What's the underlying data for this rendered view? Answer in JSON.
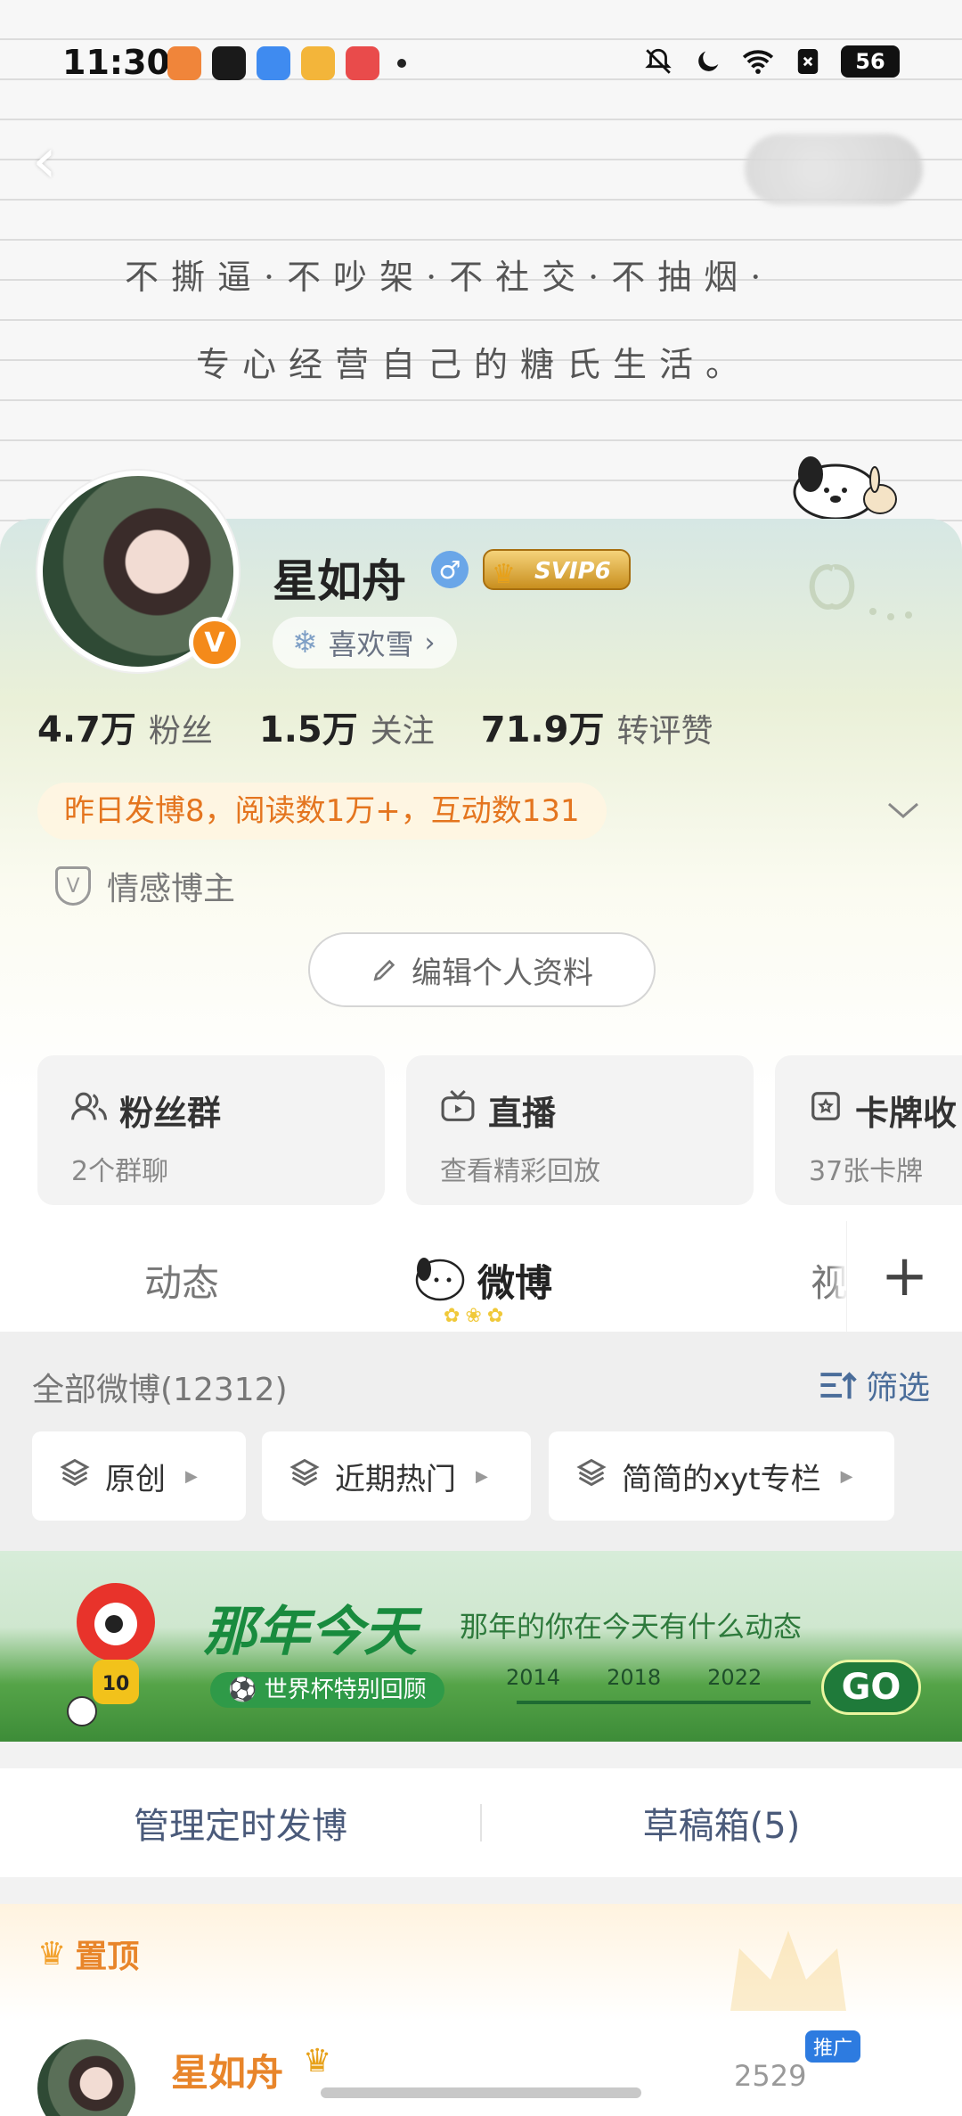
{
  "status_bar": {
    "time": "11:30",
    "app_icons": [
      {
        "name": "app-icon-video",
        "color": "#f0853a"
      },
      {
        "name": "app-icon-douyin",
        "color": "#1a1a1a"
      },
      {
        "name": "app-icon-browser",
        "color": "#3f8bf0"
      },
      {
        "name": "app-icon-reader",
        "color": "#f3b53a"
      },
      {
        "name": "app-icon-player",
        "color": "#e94b4b"
      }
    ],
    "battery": "56"
  },
  "banner": {
    "handwriting_line1": "不撕逼·不吵架·不社交·不抽烟·",
    "handwriting_line2": "专心经营自己的糖氏生活。"
  },
  "profile": {
    "name": "星如舟",
    "gender_symbol": "♂",
    "svip": "SVIP6",
    "like_tag": "喜欢雪",
    "like_arrow": "›",
    "verified_mark": "V",
    "stats": [
      {
        "value": "4.7万",
        "label": "粉丝"
      },
      {
        "value": "1.5万",
        "label": "关注"
      },
      {
        "value": "71.9万",
        "label": "转评赞"
      }
    ],
    "yesterday": "昨日发博8，阅读数1万+，互动数131",
    "tag": "情感博主",
    "edit_button": "编辑个人资料"
  },
  "features": [
    {
      "title": "粉丝群",
      "sub": "2个群聊",
      "icon": "group-icon"
    },
    {
      "title": "直播",
      "sub": "查看精彩回放",
      "icon": "tv-icon"
    },
    {
      "title": "卡牌收",
      "sub": "37张卡牌",
      "icon": "card-icon"
    }
  ],
  "tabs": [
    {
      "label": "动态"
    },
    {
      "label": "微博"
    },
    {
      "label": "视"
    }
  ],
  "tab_plus": "+",
  "filter": {
    "all_weibo": "全部微博(12312)",
    "filter_label": "筛选",
    "chips": [
      "原创",
      "近期热门",
      "简简的xyt专栏"
    ]
  },
  "promo": {
    "title": "那年今天",
    "subtitle": "那年的你在今天有什么动态",
    "cup_label": "世界杯特别回顾",
    "years": [
      "2014",
      "2018",
      "2022"
    ],
    "go": "GO"
  },
  "manage": {
    "left": "管理定时发博",
    "right": "草稿箱(5)"
  },
  "pinned": {
    "label": "置顶",
    "post_name": "星如舟",
    "ad_badge": "推广",
    "count": "2529"
  },
  "colors": {
    "accent_orange": "#e8852a",
    "link_blue": "#4a6d9a",
    "promo_green": "#198b3e"
  }
}
